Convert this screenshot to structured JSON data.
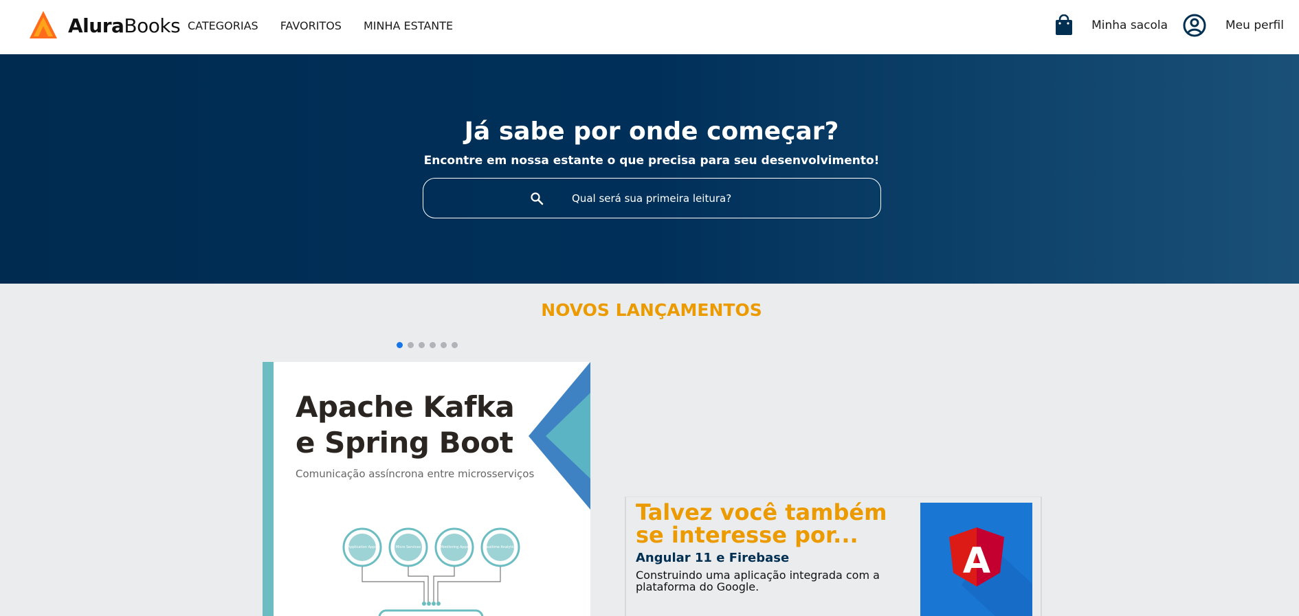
{
  "header": {
    "logo_bold": "Alura",
    "logo_regular": "Books",
    "nav": [
      "CATEGORIAS",
      "FAVORITOS",
      "MINHA ESTANTE"
    ],
    "bag_label": "Minha sacola",
    "profile_label": "Meu perfil"
  },
  "hero": {
    "title": "Já sabe por onde começar?",
    "subtitle": "Encontre em nossa estante o que precisa para seu desenvolvimento!",
    "search_placeholder": "Qual será sua primeira leitura?"
  },
  "releases": {
    "title": "NOVOS LANÇAMENTOS",
    "carousel_pages": 6,
    "active_page": 1,
    "book": {
      "title_line1": "Apache Kafka",
      "title_line2": "e Spring Boot",
      "subtitle": "Comunicação assíncrona entre microsserviços",
      "diagram_labels": [
        "Application Apps",
        "Micro Services",
        "Monitoring Apps",
        "Realtime Analytics"
      ]
    }
  },
  "suggestion": {
    "heading": "Talvez você também se interesse por...",
    "book_title": "Angular 11 e Firebase",
    "book_description": "Construindo uma aplicação integrada com a plataforma do Google.",
    "thumb_letter": "A"
  },
  "colors": {
    "accent": "#EB9B00",
    "hero_dark": "#002B50",
    "hero_light": "#1A5178",
    "brand_navy": "#002F52",
    "carousel_active": "#1875E8",
    "angular_red": "#DD1B16"
  },
  "icons": {
    "logo": "alurabooks-triangle-logo",
    "bag": "shopping-bag-icon",
    "profile": "user-circle-icon",
    "search": "search-icon"
  }
}
